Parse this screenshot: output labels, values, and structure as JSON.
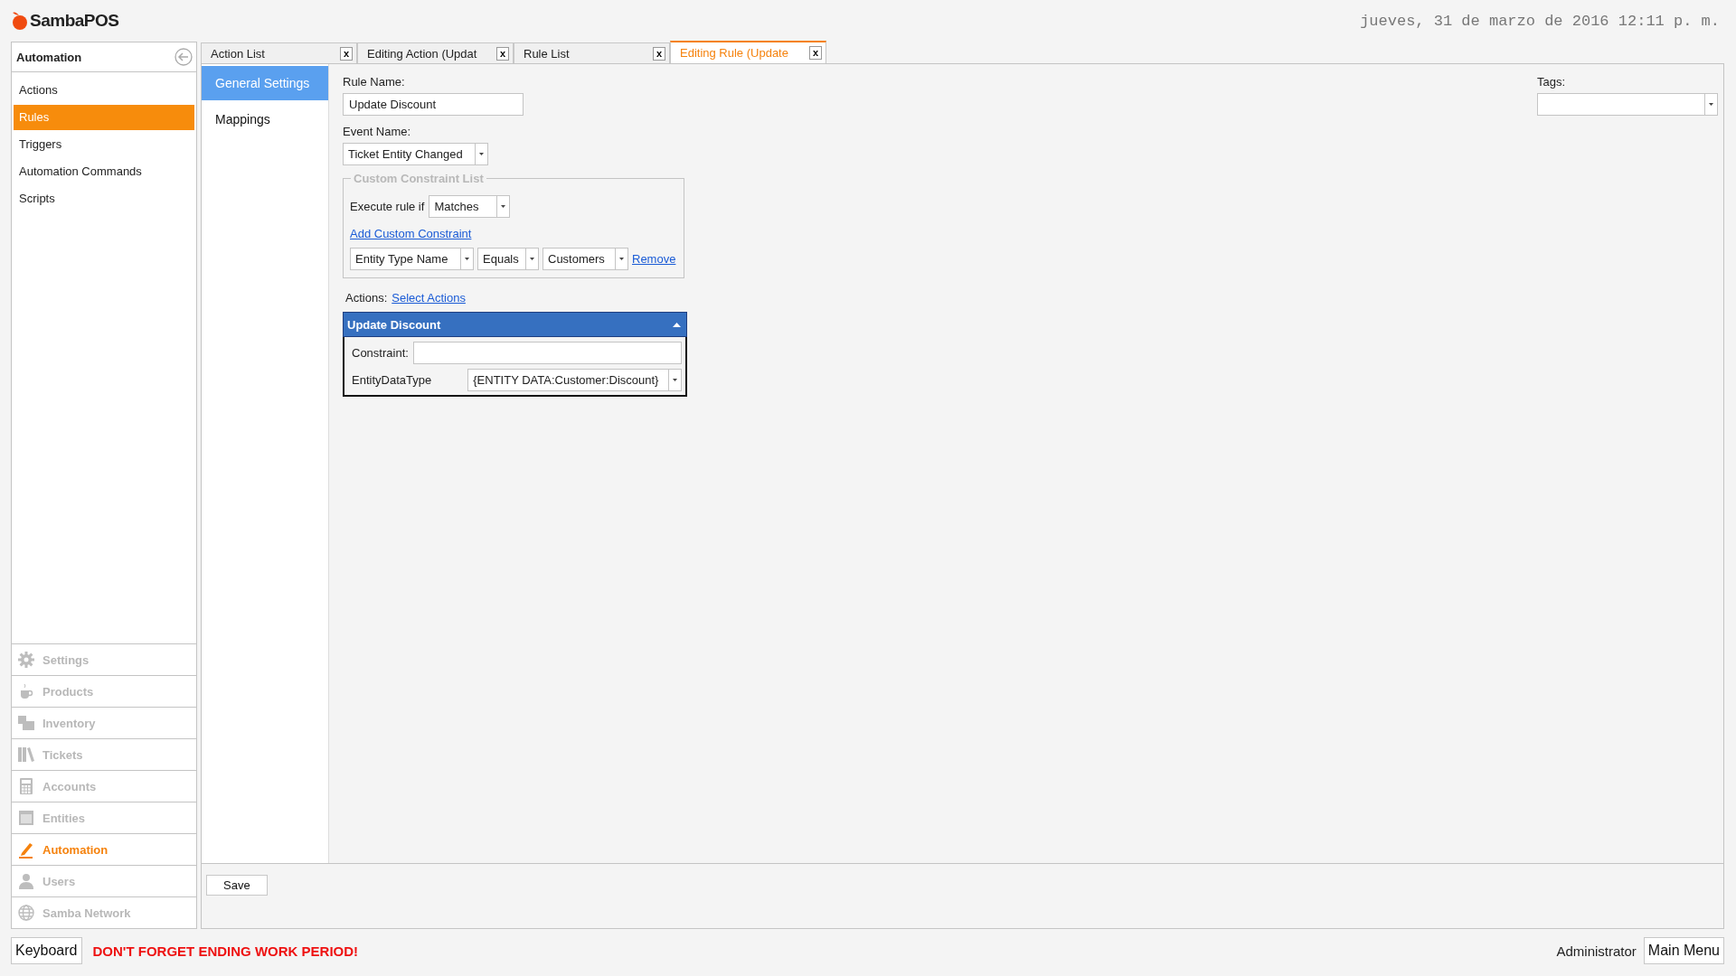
{
  "app": {
    "logo": "SambaPOS",
    "datetime": "jueves, 31 de marzo de 2016 12:11 p. m."
  },
  "sidebar": {
    "title": "Automation",
    "items": [
      {
        "label": "Actions",
        "selected": false
      },
      {
        "label": "Rules",
        "selected": true
      },
      {
        "label": "Triggers",
        "selected": false
      },
      {
        "label": "Automation Commands",
        "selected": false
      },
      {
        "label": "Scripts",
        "selected": false
      }
    ],
    "modules": [
      {
        "label": "Settings",
        "selected": false
      },
      {
        "label": "Products",
        "selected": false
      },
      {
        "label": "Inventory",
        "selected": false
      },
      {
        "label": "Tickets",
        "selected": false
      },
      {
        "label": "Accounts",
        "selected": false
      },
      {
        "label": "Entities",
        "selected": false
      },
      {
        "label": "Automation",
        "selected": true
      },
      {
        "label": "Users",
        "selected": false
      },
      {
        "label": "Samba Network",
        "selected": false
      }
    ]
  },
  "tabs": [
    {
      "label": "Action List",
      "close": "x",
      "selected": false
    },
    {
      "label": "Editing Action (Updat",
      "close": "x",
      "selected": false
    },
    {
      "label": "Rule List",
      "close": "x",
      "selected": false
    },
    {
      "label": "Editing Rule (Update",
      "close": "x",
      "selected": true
    }
  ],
  "nav": [
    {
      "label": "General Settings",
      "selected": true
    },
    {
      "label": "Mappings",
      "selected": false
    }
  ],
  "form": {
    "rule_name_label": "Rule Name:",
    "rule_name": "Update Discount",
    "event_name_label": "Event Name:",
    "event_name": "Ticket Entity Changed",
    "tags_label": "Tags:",
    "constraints": {
      "legend": "Custom Constraint List",
      "execute_label": "Execute rule if",
      "execute_value": "Matches",
      "add_link": "Add Custom Constraint",
      "rows": [
        {
          "field": "Entity Type Name",
          "operator": "Equals",
          "value": "Customers",
          "remove": "Remove"
        }
      ]
    },
    "actions_label": "Actions:",
    "select_actions_link": "Select Actions",
    "action_panel": {
      "title": "Update Discount",
      "expanded": true,
      "constraint_label": "Constraint:",
      "param_label": "EntityDataType",
      "param_value": "{ENTITY DATA:Customer:Discount}"
    }
  },
  "save_button": "Save",
  "status": {
    "keyboard": "Keyboard",
    "warning": "DON'T FORGET ENDING WORK PERIOD!",
    "user": "Administrator",
    "main_menu": "Main Menu"
  }
}
